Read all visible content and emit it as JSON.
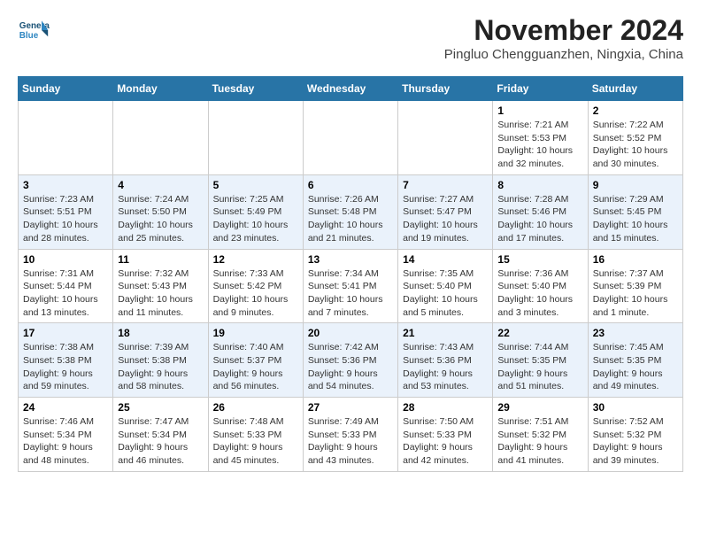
{
  "header": {
    "logo_line1": "General",
    "logo_line2": "Blue",
    "month": "November 2024",
    "location": "Pingluo Chengguanzhen, Ningxia, China"
  },
  "weekdays": [
    "Sunday",
    "Monday",
    "Tuesday",
    "Wednesday",
    "Thursday",
    "Friday",
    "Saturday"
  ],
  "weeks": [
    [
      {
        "day": "",
        "info": ""
      },
      {
        "day": "",
        "info": ""
      },
      {
        "day": "",
        "info": ""
      },
      {
        "day": "",
        "info": ""
      },
      {
        "day": "",
        "info": ""
      },
      {
        "day": "1",
        "info": "Sunrise: 7:21 AM\nSunset: 5:53 PM\nDaylight: 10 hours and 32 minutes."
      },
      {
        "day": "2",
        "info": "Sunrise: 7:22 AM\nSunset: 5:52 PM\nDaylight: 10 hours and 30 minutes."
      }
    ],
    [
      {
        "day": "3",
        "info": "Sunrise: 7:23 AM\nSunset: 5:51 PM\nDaylight: 10 hours and 28 minutes."
      },
      {
        "day": "4",
        "info": "Sunrise: 7:24 AM\nSunset: 5:50 PM\nDaylight: 10 hours and 25 minutes."
      },
      {
        "day": "5",
        "info": "Sunrise: 7:25 AM\nSunset: 5:49 PM\nDaylight: 10 hours and 23 minutes."
      },
      {
        "day": "6",
        "info": "Sunrise: 7:26 AM\nSunset: 5:48 PM\nDaylight: 10 hours and 21 minutes."
      },
      {
        "day": "7",
        "info": "Sunrise: 7:27 AM\nSunset: 5:47 PM\nDaylight: 10 hours and 19 minutes."
      },
      {
        "day": "8",
        "info": "Sunrise: 7:28 AM\nSunset: 5:46 PM\nDaylight: 10 hours and 17 minutes."
      },
      {
        "day": "9",
        "info": "Sunrise: 7:29 AM\nSunset: 5:45 PM\nDaylight: 10 hours and 15 minutes."
      }
    ],
    [
      {
        "day": "10",
        "info": "Sunrise: 7:31 AM\nSunset: 5:44 PM\nDaylight: 10 hours and 13 minutes."
      },
      {
        "day": "11",
        "info": "Sunrise: 7:32 AM\nSunset: 5:43 PM\nDaylight: 10 hours and 11 minutes."
      },
      {
        "day": "12",
        "info": "Sunrise: 7:33 AM\nSunset: 5:42 PM\nDaylight: 10 hours and 9 minutes."
      },
      {
        "day": "13",
        "info": "Sunrise: 7:34 AM\nSunset: 5:41 PM\nDaylight: 10 hours and 7 minutes."
      },
      {
        "day": "14",
        "info": "Sunrise: 7:35 AM\nSunset: 5:40 PM\nDaylight: 10 hours and 5 minutes."
      },
      {
        "day": "15",
        "info": "Sunrise: 7:36 AM\nSunset: 5:40 PM\nDaylight: 10 hours and 3 minutes."
      },
      {
        "day": "16",
        "info": "Sunrise: 7:37 AM\nSunset: 5:39 PM\nDaylight: 10 hours and 1 minute."
      }
    ],
    [
      {
        "day": "17",
        "info": "Sunrise: 7:38 AM\nSunset: 5:38 PM\nDaylight: 9 hours and 59 minutes."
      },
      {
        "day": "18",
        "info": "Sunrise: 7:39 AM\nSunset: 5:38 PM\nDaylight: 9 hours and 58 minutes."
      },
      {
        "day": "19",
        "info": "Sunrise: 7:40 AM\nSunset: 5:37 PM\nDaylight: 9 hours and 56 minutes."
      },
      {
        "day": "20",
        "info": "Sunrise: 7:42 AM\nSunset: 5:36 PM\nDaylight: 9 hours and 54 minutes."
      },
      {
        "day": "21",
        "info": "Sunrise: 7:43 AM\nSunset: 5:36 PM\nDaylight: 9 hours and 53 minutes."
      },
      {
        "day": "22",
        "info": "Sunrise: 7:44 AM\nSunset: 5:35 PM\nDaylight: 9 hours and 51 minutes."
      },
      {
        "day": "23",
        "info": "Sunrise: 7:45 AM\nSunset: 5:35 PM\nDaylight: 9 hours and 49 minutes."
      }
    ],
    [
      {
        "day": "24",
        "info": "Sunrise: 7:46 AM\nSunset: 5:34 PM\nDaylight: 9 hours and 48 minutes."
      },
      {
        "day": "25",
        "info": "Sunrise: 7:47 AM\nSunset: 5:34 PM\nDaylight: 9 hours and 46 minutes."
      },
      {
        "day": "26",
        "info": "Sunrise: 7:48 AM\nSunset: 5:33 PM\nDaylight: 9 hours and 45 minutes."
      },
      {
        "day": "27",
        "info": "Sunrise: 7:49 AM\nSunset: 5:33 PM\nDaylight: 9 hours and 43 minutes."
      },
      {
        "day": "28",
        "info": "Sunrise: 7:50 AM\nSunset: 5:33 PM\nDaylight: 9 hours and 42 minutes."
      },
      {
        "day": "29",
        "info": "Sunrise: 7:51 AM\nSunset: 5:32 PM\nDaylight: 9 hours and 41 minutes."
      },
      {
        "day": "30",
        "info": "Sunrise: 7:52 AM\nSunset: 5:32 PM\nDaylight: 9 hours and 39 minutes."
      }
    ]
  ]
}
